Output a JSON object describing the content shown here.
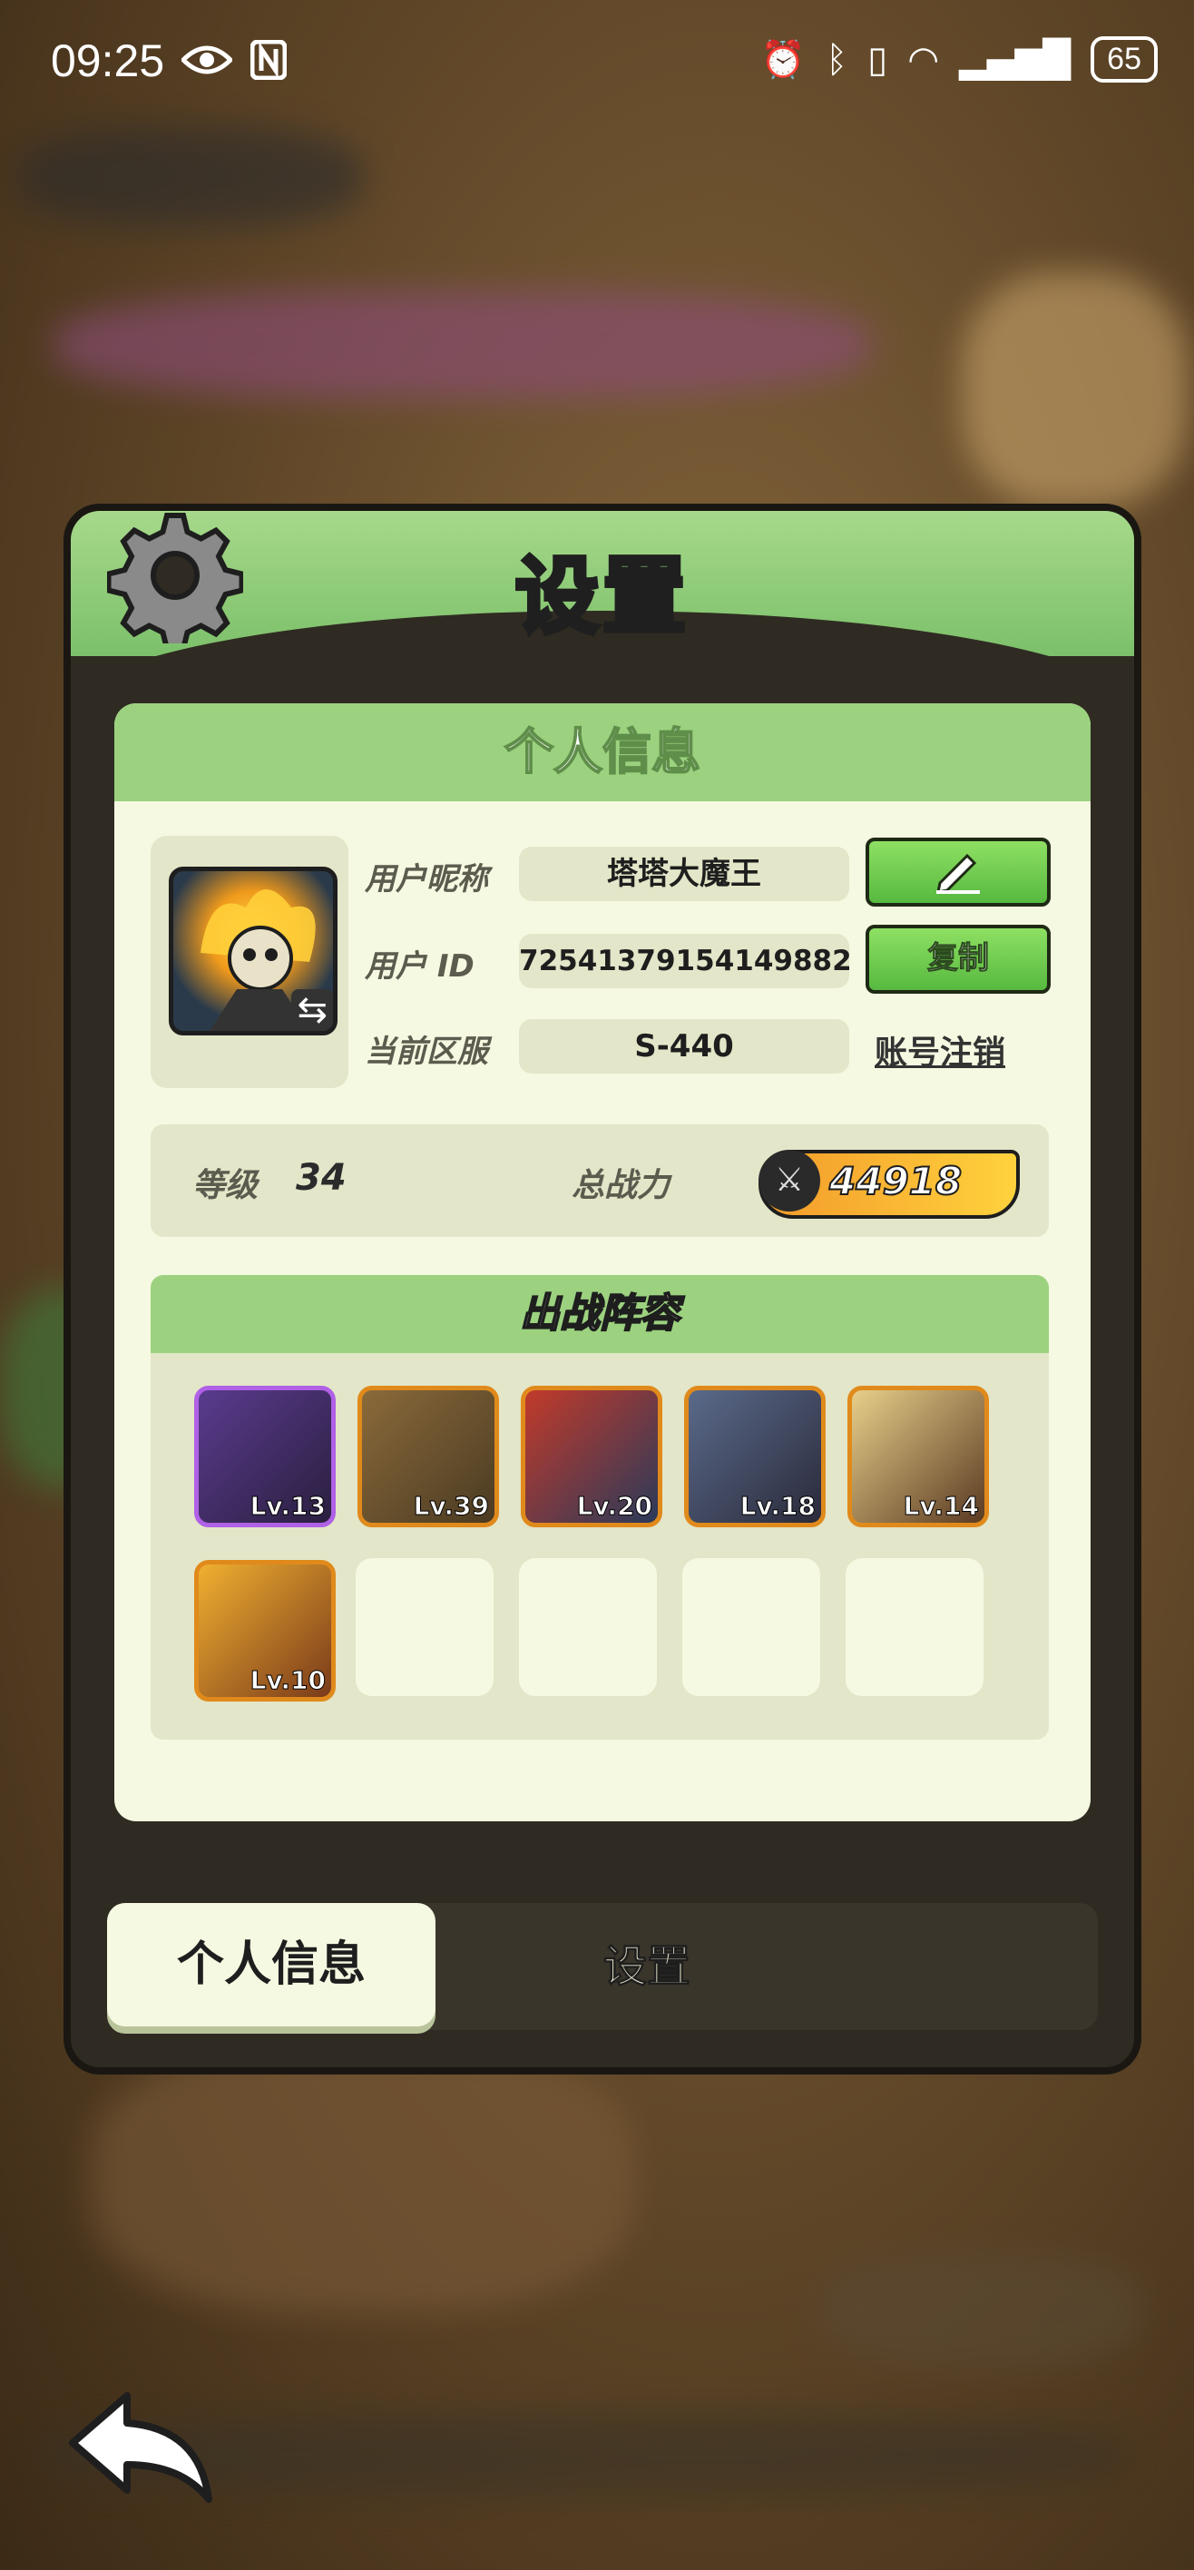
{
  "status_bar": {
    "time": "09:25",
    "battery": "65",
    "icons": [
      "eye-icon",
      "nfc-icon",
      "alarm-icon",
      "bluetooth-icon",
      "vibrate-icon",
      "wifi-icon",
      "signal-4g-icon"
    ]
  },
  "dialog": {
    "title": "设置",
    "section_title": "个人信息",
    "profile": {
      "nickname_label": "用户昵称",
      "nickname": "塔塔大魔王",
      "id_label": "用户 ID",
      "id": "72541379154149882",
      "server_label": "当前区服",
      "server": "S-440",
      "copy_label": "复制",
      "deregister_label": "账号注销"
    },
    "stats": {
      "level_label": "等级",
      "level": "34",
      "power_label": "总战力",
      "power": "44918"
    },
    "team": {
      "title": "出战阵容",
      "heroes": [
        {
          "level": "Lv.13",
          "rarity": "purple"
        },
        {
          "level": "Lv.39",
          "rarity": "orange"
        },
        {
          "level": "Lv.20",
          "rarity": "orange"
        },
        {
          "level": "Lv.18",
          "rarity": "orange"
        },
        {
          "level": "Lv.14",
          "rarity": "orange"
        },
        {
          "level": "Lv.10",
          "rarity": "orange"
        }
      ]
    },
    "tabs": {
      "active": "个人信息",
      "inactive": "设置"
    }
  },
  "colors": {
    "accent_green": "#9cd27f",
    "card_bg": "#f6f9e1",
    "orange_frame": "#e08a1c",
    "purple_frame": "#b061e6"
  }
}
